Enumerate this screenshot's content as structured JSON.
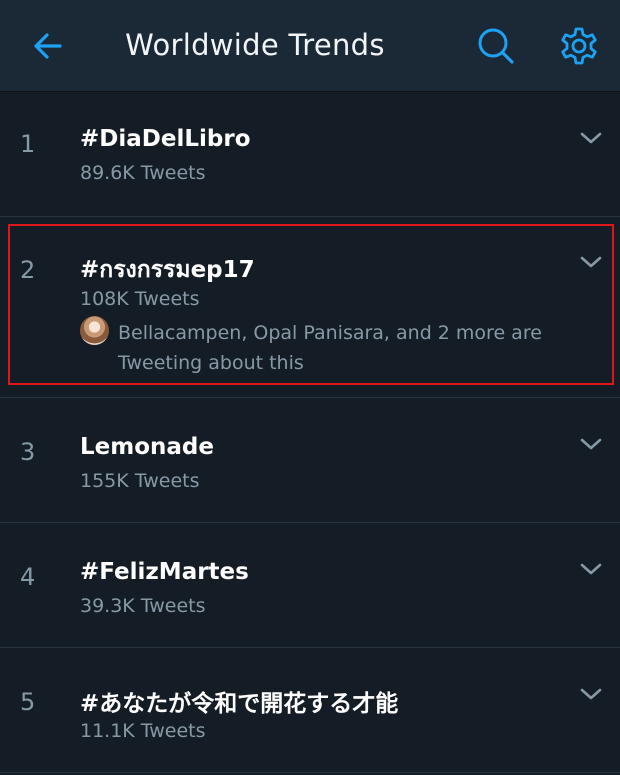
{
  "header": {
    "title": "Worldwide Trends",
    "back_icon": "back-arrow-icon",
    "search_icon": "search-icon",
    "settings_icon": "gear-icon",
    "accent_color": "#1da1f2"
  },
  "trends": [
    {
      "rank": "1",
      "name": "#DiaDelLibro",
      "tweets": "89.6K Tweets"
    },
    {
      "rank": "2",
      "name": "#กรงกรรมep17",
      "tweets": "108K Tweets",
      "social_context": "Bellacampen, Opal Panisara, and 2 more are Tweeting about this"
    },
    {
      "rank": "3",
      "name": "Lemonade",
      "tweets": "155K Tweets"
    },
    {
      "rank": "4",
      "name": "#FelizMartes",
      "tweets": "39.3K Tweets"
    },
    {
      "rank": "5",
      "name": "#あなたが令和で開花する才能",
      "tweets": "11.1K Tweets"
    }
  ],
  "highlight_color": "#e0141a"
}
